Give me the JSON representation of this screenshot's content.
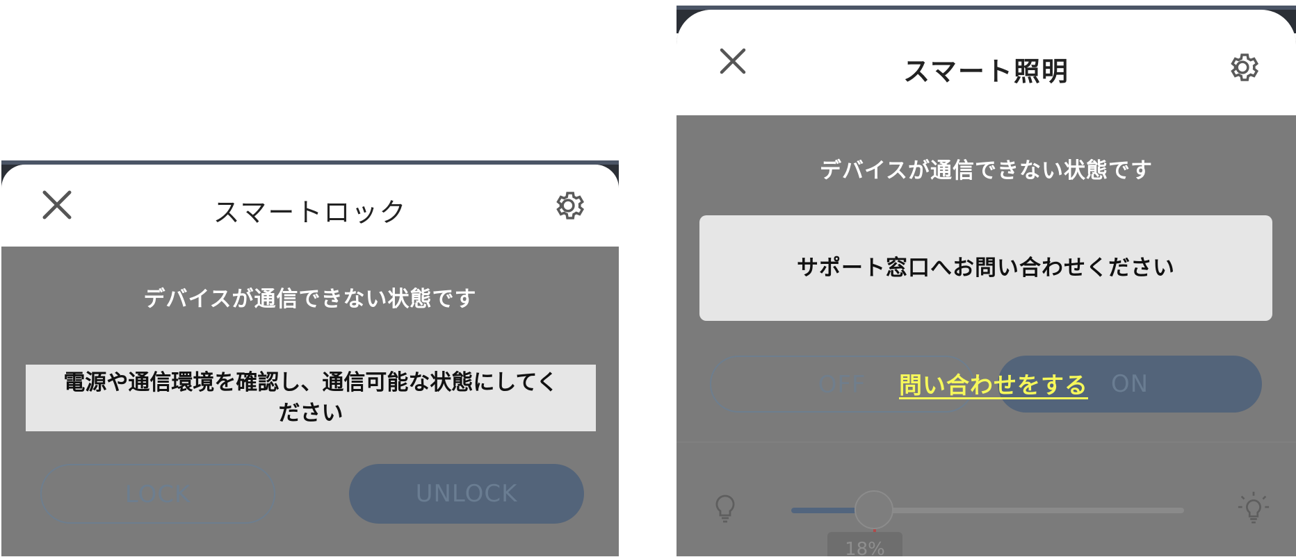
{
  "left_panel": {
    "title": "スマートロック",
    "status_message": "デバイスが通信できない状態です",
    "notice_line1": "電源や通信環境を確認し、通信可能な状態にしてく",
    "notice_line2": "ださい",
    "buttons": {
      "lock": "LOCK",
      "unlock": "UNLOCK"
    },
    "icons": {
      "close": "close-icon",
      "settings": "gear-icon"
    }
  },
  "right_panel": {
    "title": "スマート照明",
    "status_message": "デバイスが通信できない状態です",
    "notice": "サポート窓口へお問い合わせください",
    "contact_link": "問い合わせをする",
    "buttons": {
      "off": "OFF",
      "on": "ON"
    },
    "brightness": {
      "value": 18,
      "label": "18%"
    },
    "icons": {
      "close": "close-icon",
      "settings": "gear-icon",
      "dim": "bulb-dim-icon",
      "bright": "bulb-bright-icon"
    }
  },
  "colors": {
    "overlay": "#7b7b7b",
    "link": "#f6f85a",
    "accent": "#53647a",
    "notice_bg": "#e6e6e6"
  }
}
